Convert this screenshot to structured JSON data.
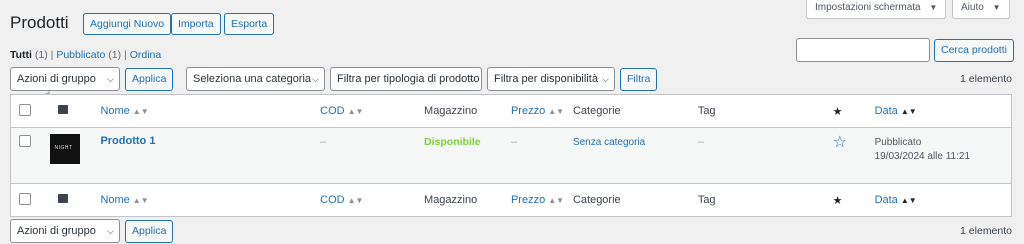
{
  "page": {
    "title": "Prodotti",
    "add_new": "Aggiungi Nuovo",
    "import": "Importa",
    "export": "Esporta",
    "screen_options": "Impostazioni schermata",
    "help": "Aiuto"
  },
  "views": {
    "all": "Tutti",
    "all_count": "(1)",
    "published": "Pubblicato",
    "published_count": "(1)",
    "order": "Ordina",
    "sep": "|"
  },
  "search": {
    "value": "",
    "button": "Cerca prodotti"
  },
  "filters": {
    "bulk_action": "Azioni di gruppo",
    "apply": "Applica",
    "category": "Seleziona una categoria",
    "type": "Filtra per tipologia di prodotto",
    "stock": "Filtra per disponibilità",
    "filter_button": "Filtra",
    "count_top": "1 elemento"
  },
  "columns": {
    "name": "Nome",
    "sku": "COD",
    "stock": "Magazzino",
    "price": "Prezzo",
    "categories": "Categorie",
    "tags": "Tag",
    "date": "Data"
  },
  "rows": [
    {
      "name": "Prodotto 1",
      "thumb_text": "NIGHT",
      "sku": "–",
      "stock": "Disponibile",
      "price": "–",
      "category": "Senza categoria",
      "tags": "–",
      "status": "Pubblicato",
      "date": "19/03/2024 alle 11:21"
    }
  ],
  "bottom": {
    "bulk_action": "Azioni di gruppo",
    "apply": "Applica",
    "count": "1 elemento"
  },
  "icons": {
    "sort": "sort-arrows-icon",
    "chevron": "chevron-down-icon",
    "image": "image-icon",
    "featured": "star-icon"
  }
}
